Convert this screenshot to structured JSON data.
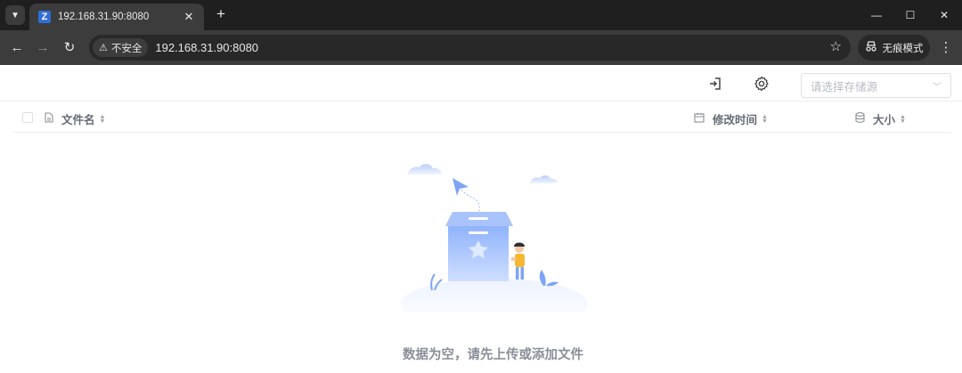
{
  "browser": {
    "tab": {
      "title": "192.168.31.90:8080",
      "favicon_letter": "Z"
    },
    "address": {
      "security_label": "不安全",
      "url": "192.168.31.90:8080"
    },
    "profile_label": "无痕模式",
    "colors": {
      "frame": "#1f1f1f",
      "toolbar": "#3c3c3c",
      "omnibox": "#282828"
    }
  },
  "app": {
    "storage_select": {
      "placeholder": "请选择存储源"
    },
    "table": {
      "columns": [
        {
          "label": "文件名",
          "icon": "file-icon"
        },
        {
          "label": "修改时间",
          "icon": "calendar-icon"
        },
        {
          "label": "大小",
          "icon": "database-icon"
        }
      ]
    },
    "empty": {
      "message": "数据为空，请先上传或添加文件"
    },
    "colors": {
      "accent": "#7da4f5",
      "text_muted": "#8a8f99"
    }
  }
}
